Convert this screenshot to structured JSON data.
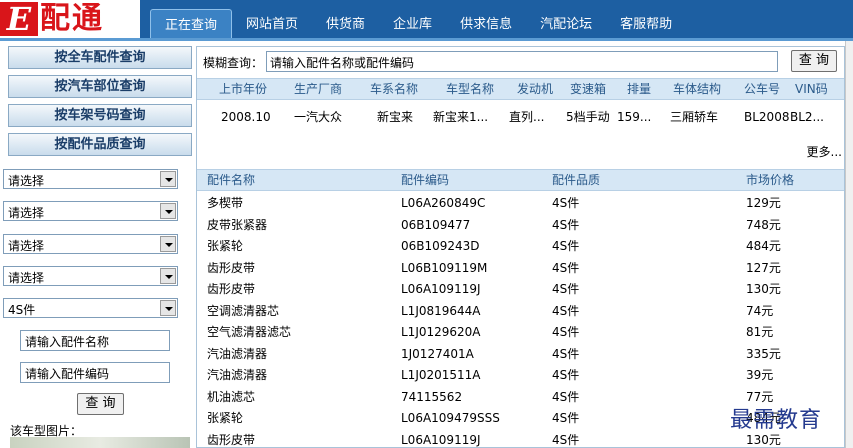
{
  "logo": {
    "e": "E",
    "rest": "配通"
  },
  "nav": [
    "正在查询",
    "网站首页",
    "供货商",
    "企业库",
    "供求信息",
    "汽配论坛",
    "客服帮助"
  ],
  "sidebar": {
    "buttons": [
      "按全车配件查询",
      "按汽车部位查询",
      "按车架号码查询",
      "按配件品质查询"
    ],
    "selects": [
      "请选择",
      "请选择",
      "请选择",
      "请选择",
      "4S件"
    ],
    "part_name_placeholder": "请输入配件名称",
    "part_code_placeholder": "请输入配件编码",
    "query_button": "查 询",
    "car_image_label": "该车型图片："
  },
  "search": {
    "label": "模糊查询：",
    "value": "请输入配件名称或配件编码",
    "button": "查 询"
  },
  "vehicle_table": {
    "headers": [
      "上市年份",
      "生产厂商",
      "车系名称",
      "车型名称",
      "发动机",
      "变速箱",
      "排量",
      "车体结构",
      "公车号",
      "VIN码"
    ],
    "row": [
      "2008.10",
      "一汽大众",
      "新宝来",
      "新宝来1...",
      "直列...",
      "5档手动",
      "159...",
      "三厢轿车",
      "BL2008",
      "BL2..."
    ],
    "more": "更多..."
  },
  "parts_table": {
    "headers": [
      "配件名称",
      "配件编码",
      "配件品质",
      "市场价格"
    ],
    "rows": [
      [
        "多楔带",
        "L06A260849C",
        "4S件",
        "129元"
      ],
      [
        "皮带张紧器",
        "06B109477",
        "4S件",
        "748元"
      ],
      [
        "张紧轮",
        "06B109243D",
        "4S件",
        "484元"
      ],
      [
        "齿形皮带",
        "L06B109119M",
        "4S件",
        "127元"
      ],
      [
        "齿形皮带",
        "L06A109119J",
        "4S件",
        "130元"
      ],
      [
        "空调滤清器芯",
        "L1J0819644A",
        "4S件",
        "74元"
      ],
      [
        "空气滤清器滤芯",
        "L1J0129620A",
        "4S件",
        "81元"
      ],
      [
        "汽油滤清器",
        "1J0127401A",
        "4S件",
        "335元"
      ],
      [
        "汽油滤清器",
        "L1J0201511A",
        "4S件",
        "39元"
      ],
      [
        "机油滤芯",
        "74115562",
        "4S件",
        "77元"
      ],
      [
        "张紧轮",
        "L06A109479SSS",
        "4S件",
        "484元"
      ],
      [
        "齿形皮带",
        "L06A109119J",
        "4S件",
        "130元"
      ]
    ]
  },
  "watermark": "最需教育",
  "colors": {
    "topbar": "#1d5fa2",
    "logo_red": "#d9151a",
    "header_blue": "#d6e7f5"
  }
}
